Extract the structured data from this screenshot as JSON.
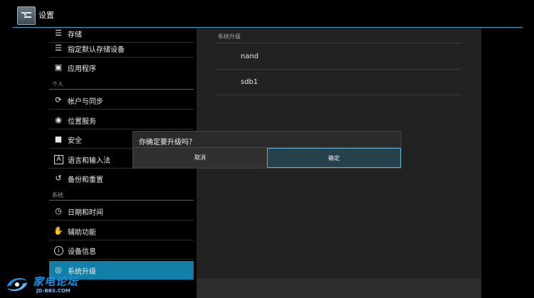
{
  "header": {
    "title": "设置",
    "icon": "settings-sliders-icon"
  },
  "left_panel": {
    "items_top": [
      {
        "label": "存储",
        "icon": "storage-icon"
      },
      {
        "label": "指定默认存储设备",
        "icon": "storage-icon"
      },
      {
        "label": "应用程序",
        "icon": "image-icon"
      }
    ],
    "section_personal": "个人",
    "items_personal": [
      {
        "label": "帐户与同步",
        "icon": "sync-icon"
      },
      {
        "label": "位置服务",
        "icon": "location-icon"
      },
      {
        "label": "安全",
        "icon": "lock-icon"
      },
      {
        "label": "语言和输入法",
        "icon": "keyboard-a-icon"
      },
      {
        "label": "备份和重置",
        "icon": "backup-icon"
      }
    ],
    "section_system": "系统",
    "items_system": [
      {
        "label": "日期和时间",
        "icon": "clock-icon"
      },
      {
        "label": "辅助功能",
        "icon": "hand-icon"
      },
      {
        "label": "设备信息",
        "icon": "info-icon"
      },
      {
        "label": "系统升级",
        "icon": "update-icon",
        "selected": true
      }
    ]
  },
  "right_panel": {
    "section_title": "系统升级",
    "options": [
      "nand",
      "sdb1"
    ]
  },
  "dialog": {
    "title": "你确定要升级吗？",
    "cancel_label": "取消",
    "ok_label": "确定"
  },
  "watermark": {
    "text": "家电论坛",
    "sub": "JD-BBS.COM"
  },
  "colors": {
    "accent": "#127fa8",
    "header_line": "#3aa3c9",
    "dialog_ok_border": "#5ab1cf"
  }
}
